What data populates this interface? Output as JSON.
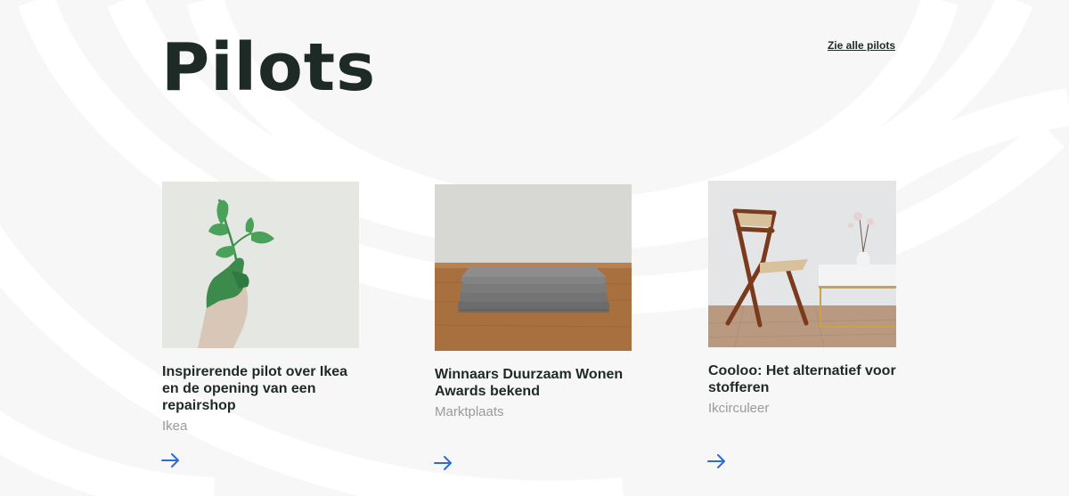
{
  "header": {
    "title": "Pilots",
    "see_all_label": "Zie alle pilots"
  },
  "cards": [
    {
      "title": "Inspirerende pilot over Ikea en de opening van een repairshop",
      "org": "Ikea",
      "image": "hand-holding-plant-photo",
      "arrow": "arrow-right-icon"
    },
    {
      "title": "Winnaars Duurzaam Wonen Awards bekend",
      "org": "Marktplaats",
      "image": "folded-felt-stack-photo",
      "arrow": "arrow-right-icon"
    },
    {
      "title": "Cooloo: Het alternatief voor stofferen",
      "org": "Ikcirculeer",
      "image": "folding-chair-photo",
      "arrow": "arrow-right-icon"
    }
  ],
  "colors": {
    "background": "#f7f7f7",
    "text": "#1e2a25",
    "muted": "#9a9a9a",
    "accent": "#2f6bd6"
  }
}
